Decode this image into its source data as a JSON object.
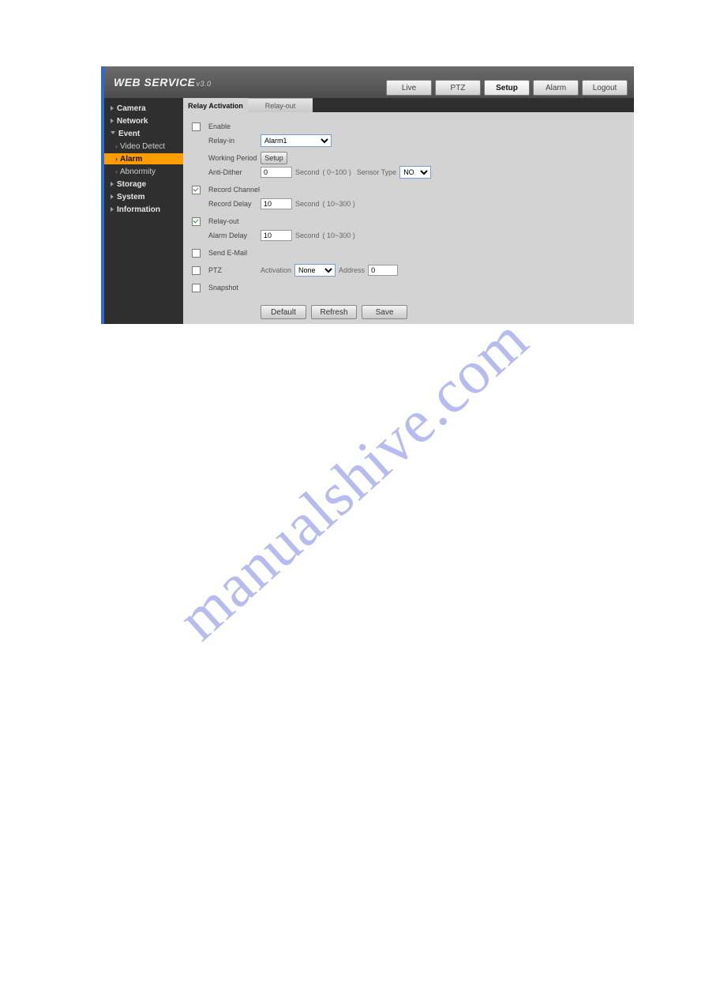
{
  "watermark": "manualshive.com",
  "header": {
    "brand": "WEB  SERVICE",
    "version": "v3.0",
    "nav": {
      "live": "Live",
      "ptz": "PTZ",
      "setup": "Setup",
      "alarm": "Alarm",
      "logout": "Logout"
    }
  },
  "sidebar": {
    "camera": "Camera",
    "network": "Network",
    "event": "Event",
    "video_detect": "Video Detect",
    "alarm": "Alarm",
    "abnormity": "Abnormity",
    "storage": "Storage",
    "system": "System",
    "information": "Information"
  },
  "tabs": {
    "relay_activation": "Relay Activation",
    "relay_out": "Relay-out"
  },
  "form": {
    "enable": "Enable",
    "relay_in": "Relay-in",
    "relay_in_value": "Alarm1",
    "working_period": "Working Period",
    "setup_btn": "Setup",
    "anti_dither": "Anti-Dither",
    "anti_dither_value": "0",
    "second": "Second",
    "range_0_100": "( 0~100 )",
    "sensor_type": "Sensor Type",
    "sensor_type_value": "NO",
    "record_channel": "Record Channel",
    "record_delay": "Record Delay",
    "record_delay_value": "10",
    "range_10_300": "( 10~300 )",
    "relay_out": "Relay-out",
    "alarm_delay": "Alarm Delay",
    "alarm_delay_value": "10",
    "send_email": "Send E-Mail",
    "ptz": "PTZ",
    "activation": "Activation",
    "activation_value": "None",
    "address": "Address",
    "address_value": "0",
    "snapshot": "Snapshot"
  },
  "buttons": {
    "default": "Default",
    "refresh": "Refresh",
    "save": "Save"
  }
}
